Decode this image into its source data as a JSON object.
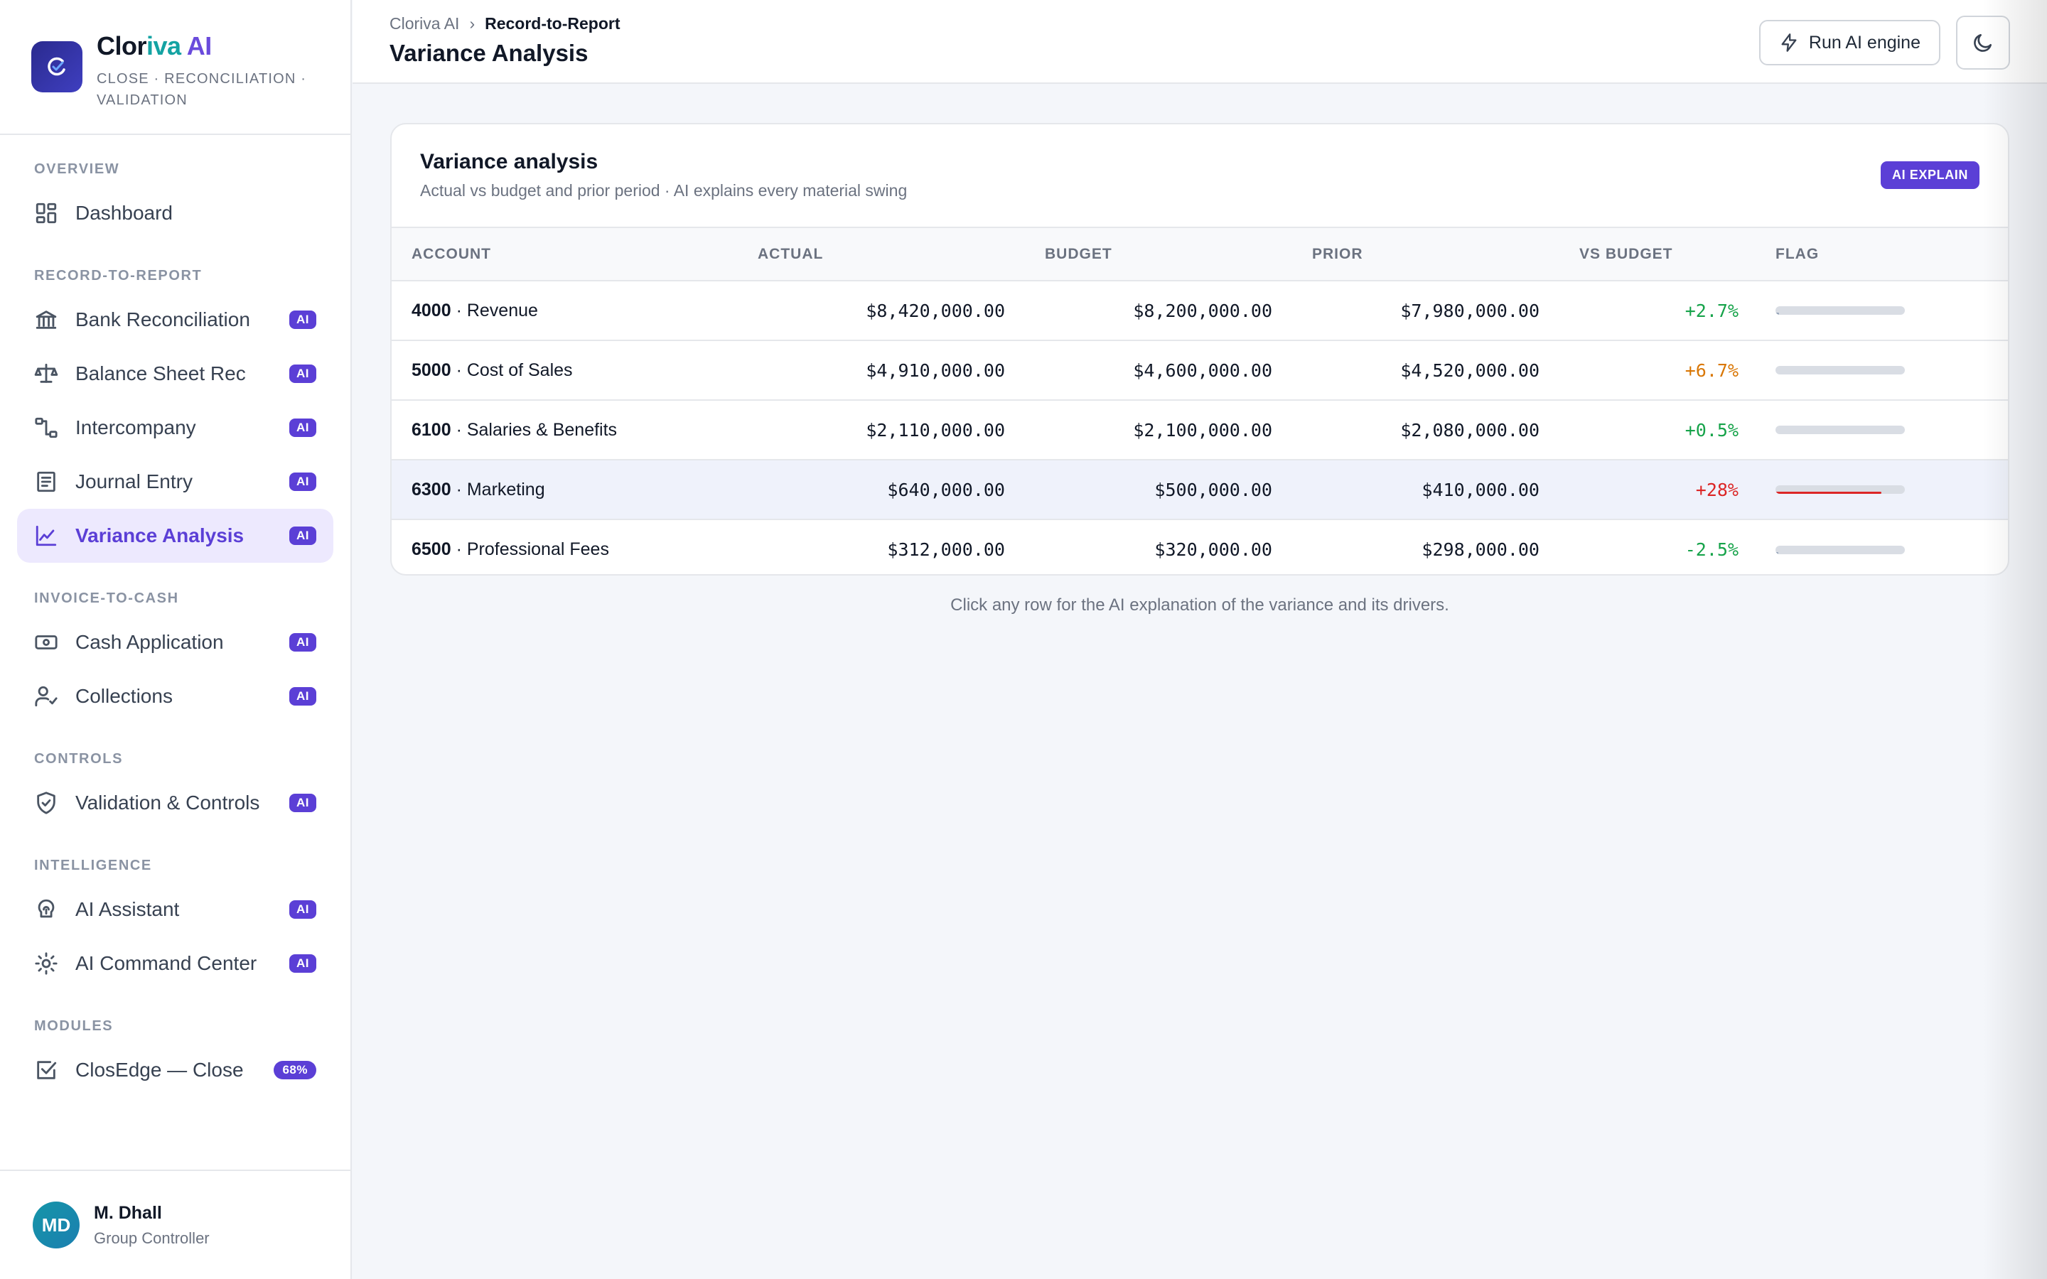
{
  "brand": {
    "name_part1": "Clor",
    "name_part2": "iva",
    "name_part3": " AI",
    "subtitle": "CLOSE · RECONCILIATION · VALIDATION"
  },
  "nav": {
    "overview": {
      "title": "OVERVIEW",
      "items": [
        {
          "label": "Dashboard",
          "icon": "dashboard-icon"
        }
      ]
    },
    "r2r": {
      "title": "RECORD-TO-REPORT",
      "items": [
        {
          "label": "Bank Reconciliation",
          "badge": "AI",
          "icon": "bank-icon"
        },
        {
          "label": "Balance Sheet Rec",
          "badge": "AI",
          "icon": "scale-icon"
        },
        {
          "label": "Intercompany",
          "badge": "AI",
          "icon": "flow-icon"
        },
        {
          "label": "Journal Entry",
          "badge": "AI",
          "icon": "journal-icon"
        },
        {
          "label": "Variance Analysis",
          "badge": "AI",
          "icon": "chart-line-icon",
          "active": true
        }
      ]
    },
    "i2c": {
      "title": "INVOICE-TO-CASH",
      "items": [
        {
          "label": "Cash Application",
          "badge": "AI",
          "icon": "cash-icon"
        },
        {
          "label": "Collections",
          "badge": "AI",
          "icon": "user-check-icon"
        }
      ]
    },
    "controls": {
      "title": "CONTROLS",
      "items": [
        {
          "label": "Validation & Controls",
          "badge": "AI",
          "icon": "shield-check-icon"
        }
      ]
    },
    "intel": {
      "title": "INTELLIGENCE",
      "items": [
        {
          "label": "AI Assistant",
          "badge": "AI",
          "icon": "ai-brain-icon"
        },
        {
          "label": "AI Command Center",
          "badge": "AI",
          "icon": "sun-gear-icon"
        }
      ]
    },
    "modules": {
      "title": "MODULES",
      "items": [
        {
          "label": "ClosEdge — Close",
          "badge": "68%",
          "icon": "checkbox-icon"
        }
      ]
    }
  },
  "user": {
    "initials": "MD",
    "name": "M. Dhall",
    "role": "Group Controller"
  },
  "header": {
    "breadcrumb_root": "Cloriva AI",
    "breadcrumb_sep": "›",
    "breadcrumb_current": "Record-to-Report",
    "title": "Variance Analysis",
    "run_label": "Run AI engine"
  },
  "card": {
    "title": "Variance analysis",
    "subtitle": "Actual vs budget and prior period · AI explains every material swing",
    "badge": "AI EXPLAIN",
    "columns": [
      "ACCOUNT",
      "ACTUAL",
      "BUDGET",
      "PRIOR",
      "VS BUDGET",
      "FLAG"
    ],
    "rows": [
      {
        "code": "4000",
        "name": "Revenue",
        "actual": "$8,420,000.00",
        "budget": "$8,200,000.00",
        "prior": "$7,980,000.00",
        "vs": "+2.7%",
        "vs_color": "#16a34a",
        "flag_level": 0.03,
        "flag_color": "#94a3b8"
      },
      {
        "code": "5000",
        "name": "Cost of Sales",
        "actual": "$4,910,000.00",
        "budget": "$4,600,000.00",
        "prior": "$4,520,000.00",
        "vs": "+6.7%",
        "vs_color": "#d97706",
        "flag_level": 0.0,
        "flag_color": "#94a3b8"
      },
      {
        "code": "6100",
        "name": "Salaries & Benefits",
        "actual": "$2,110,000.00",
        "budget": "$2,100,000.00",
        "prior": "$2,080,000.00",
        "vs": "+0.5%",
        "vs_color": "#16a34a",
        "flag_level": 0.0,
        "flag_color": "#94a3b8"
      },
      {
        "code": "6300",
        "name": "Marketing",
        "actual": "$640,000.00",
        "budget": "$500,000.00",
        "prior": "$410,000.00",
        "vs": "+28%",
        "vs_color": "#dc2626",
        "flag_level": 0.82,
        "flag_color": "#dc2626",
        "highlight": true
      },
      {
        "code": "6500",
        "name": "Professional Fees",
        "actual": "$312,000.00",
        "budget": "$320,000.00",
        "prior": "$298,000.00",
        "vs": "-2.5%",
        "vs_color": "#16a34a",
        "flag_level": 0.02,
        "flag_color": "#94a3b8"
      }
    ],
    "hint": "Click any row for the AI explanation of the variance and its drivers."
  }
}
